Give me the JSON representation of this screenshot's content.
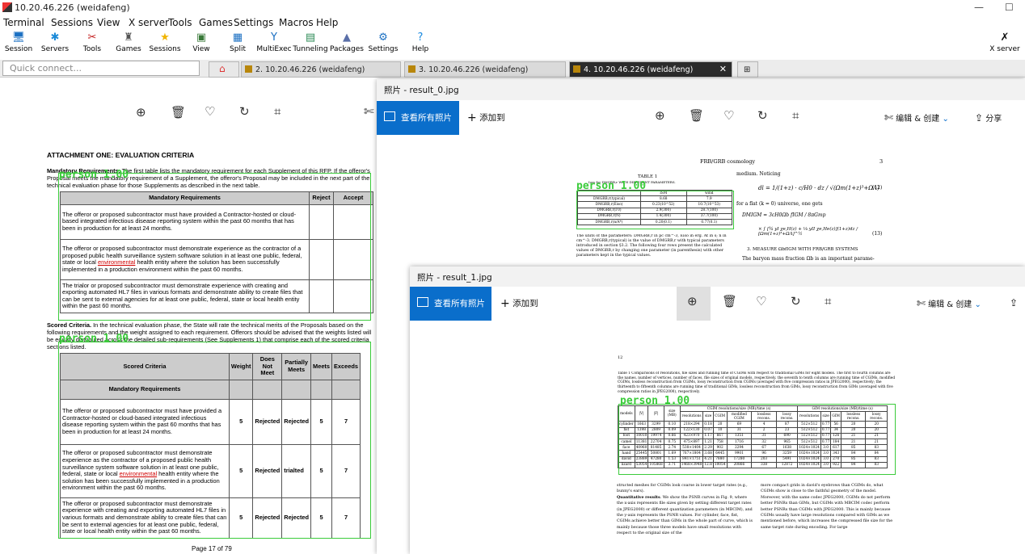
{
  "window": {
    "title": "10.20.46.226 (weidafeng)",
    "minimize": "—",
    "maximize": "☐"
  },
  "menu": [
    "Terminal",
    "Sessions",
    "View",
    "X server",
    "Tools",
    "Games",
    "Settings",
    "Macros",
    "Help"
  ],
  "toolbar": [
    {
      "label": "Session",
      "icon": "session-icon",
      "glyph": "🖥",
      "color": "#1a6fc2"
    },
    {
      "label": "Servers",
      "icon": "servers-icon",
      "glyph": "✱",
      "color": "#1b8ad8"
    },
    {
      "label": "Tools",
      "icon": "tools-icon",
      "glyph": "✂",
      "color": "#c21a1a"
    },
    {
      "label": "Games",
      "icon": "games-icon",
      "glyph": "♜",
      "color": "#555555"
    },
    {
      "label": "Sessions",
      "icon": "star-icon",
      "glyph": "★",
      "color": "#f0b400"
    },
    {
      "label": "View",
      "icon": "view-icon",
      "glyph": "▣",
      "color": "#3a7a3a"
    },
    {
      "label": "Split",
      "icon": "split-icon",
      "glyph": "▦",
      "color": "#1a6fc2"
    },
    {
      "label": "MultiExec",
      "icon": "multiexec-icon",
      "glyph": "Y",
      "color": "#1a6fc2"
    },
    {
      "label": "Tunneling",
      "icon": "tunneling-icon",
      "glyph": "▤",
      "color": "#2e8b57"
    },
    {
      "label": "Packages",
      "icon": "packages-icon",
      "glyph": "▲",
      "color": "#5a6fa8"
    },
    {
      "label": "Settings",
      "icon": "settings-icon",
      "glyph": "⚙",
      "color": "#1a6fc2"
    },
    {
      "label": "Help",
      "icon": "help-icon",
      "glyph": "?",
      "color": "#1a8ae0"
    }
  ],
  "xserver": {
    "label": "X server",
    "icon": "x-server-icon"
  },
  "quickconnect": {
    "placeholder": "Quick connect..."
  },
  "tabs": [
    {
      "label": "2. 10.20.46.226 (weidafeng)",
      "active": false
    },
    {
      "label": "3. 10.20.46.226 (weidafeng)",
      "active": false
    },
    {
      "label": "4. 10.20.46.226 (weidafeng)",
      "active": true
    }
  ],
  "left_doc": {
    "heading": "ATTACHMENT ONE:  EVALUATION CRITERIA",
    "para1_bold": "Mandatory Requirements.",
    "para1": "  The first table lists the mandatory requirement for each Supplement of this RFP.  If the offeror's Proposal meets the mandatory requirement of a Supplement, the offeror's Proposal may be included in the next part of the technical evaluation phase for those Supplements as described in the next table.",
    "t1_headers": [
      "Mandatory Requirements",
      "Reject",
      "Accept"
    ],
    "t1_rows": [
      "The offeror or proposed subcontractor must have provided a Contractor-hosted or cloud-based integrated infectious disease reporting system within the past 60 months that has been in production for at least 24 months.",
      "The offeror or proposed subcontractor must demonstrate experience as the contractor of a proposed public health surveillance system software solution in at least one public, federal, state or local ",
      "The trialor or proposed subcontractor must demonstrate experience with creating and exporting automated HL7 files in various formats and demonstrate ability to create files that can be sent to external agencies for at least one public, federal, state or local health entity within the past 60 months."
    ],
    "t1_red": "environmental",
    "t1_row2_tail": " health entity where the solution has been successfully implemented in a production environment within the past 60 months.",
    "para2_bold": "Scored Criteria.",
    "para2": "  In the technical evaluation phase, the State will rate the technical merits of the Proposals based on the following requirements and the weight assigned to each requirement.  Offerors should be advised that the weights listed will be equally distributed across the detailed sub-requirements (See Supplements 1) that comprise each of the scored criteria sections listed.",
    "t2_headers": [
      "Scored Criteria",
      "Weight",
      "Does Not Meet",
      "Partially Meets",
      "Meets",
      "Exceeds"
    ],
    "t2_section": "Mandatory Requirements",
    "t2_rows": [
      {
        "text": "The offeror or proposed subcontractor must have provided a Contractor-hosted or cloud-based integrated infectious disease reporting system within the past 60 months that has been in production for at least 24 months.",
        "weight": "5",
        "dnm": "Rejected",
        "pm": "Rejected",
        "meets": "5",
        "exc": "7"
      },
      {
        "text": "The offeror or proposed subcontractor must demonstrate experience as the contractor of a proposed public health surveillance system software solution in at least one public, federal, state or local ",
        "weight": "5",
        "dnm": "Rejected",
        "pm": "trialted",
        "meets": "5",
        "exc": "7"
      },
      {
        "text": "The offeror or proposed subcontractor must demonstrate experience with creating and exporting automated HL7 files in various formats and demonstrate ability to create files that can be sent to external agencies for at least one public, federal, state or local health entity within the past 60 months.",
        "weight": "5",
        "dnm": "Rejected",
        "pm": "Rejected",
        "meets": "5",
        "exc": "7"
      }
    ],
    "page": "Page 17 of 79",
    "label": "person 1.00"
  },
  "win0": {
    "title": "照片 - result_0.jpg",
    "view_all": "查看所有照片",
    "add_to": "添加到",
    "edit": "编辑 & 创建",
    "share": "分享",
    "header": "FRB/GRB cosmology",
    "page_no": "3",
    "table_caption": "TABLE 1",
    "table_sub": "Ioss for DMGRB,r WITH DIFFERENT PARAMETERS.",
    "label": "person 1.00",
    "cols": [
      "",
      "ISM",
      "wind"
    ],
    "rows": [
      [
        "DMGRB,r(typical)",
        "8.68",
        "7.9"
      ],
      [
        "DMGRB,r(Eiso)",
        "0.23(10^52)",
        "10.7(10^53)"
      ],
      [
        "DMGRB,r(Γ0)",
        "2.9(300)",
        "28.7(100)"
      ],
      [
        "DMGRB,r(N)",
        "1.4(300)",
        "37.7(100)"
      ],
      [
        "DMGRB,r(n/A*)",
        "0.20(0.1)",
        "0.77(0.1)"
      ]
    ],
    "text_left": "The units of the parameters: DMGRB,r in pc cm^-3, Eiso in erg. At in s; n in cm^-3. DMGRB,r(typical) is the value of DMGRB,r with typical parameters introduced in section §3.2. The following four rows present the calculated values of DMGRB,r by changing one parameter (in parenthesis) with other parameters kept in the typical values.",
    "text_right1": "medium. Noticing",
    "eq_num1": "(12)",
    "text_right2": "for a flat (k = 0) universe, one gets",
    "eq_num2": "(13)",
    "section": "3.  MEASURE ΩbfIGM WITH FRB/GRB SYSTEMS",
    "text_right3": "The baryon mass fraction Ωb is an important parame-"
  },
  "win1": {
    "title": "照片 - result_1.jpg",
    "view_all": "查看所有照片",
    "add_to": "添加到",
    "edit": "编辑 & 创建",
    "page_no": "12",
    "caption": "Table 1 Comparisons of resolutions, file sizes and running time of CGIMs with respect to traditional GIMs for eight models. The first to fourth columns are the names, number of vertices, number of faces, file sizes of original models, respectively. the seventh to tenth columns are running time of CGIMs, modified CGIMs, lossless reconstruction from CGIMs, lossy reconstruction from CGIMs (averaged with five compression ratios in JPEG2000), respectively; the thirteenth to fifteenth columns are running time of traditional GIMs, lossless reconstruction from GIMs, lossy reconstruction from GIMs (averaged with five compression ratios in JPEG2000), respectively.",
    "label": "person 1.00",
    "head1": [
      "models",
      "|V|",
      "|F|",
      "size (MB)",
      "CGIM resolutions/size (MB)/time (s)",
      "GIM resolutions/size (MB)/time (s)"
    ],
    "head2": [
      "resolutions",
      "size",
      "CGIM",
      "modified CGIM",
      "lossless recons.",
      "lossy recons.",
      "resolutions",
      "size",
      "GIM",
      "lossless recons.",
      "lossy recons."
    ],
    "rows": [
      [
        "cylinder",
        "1663",
        "3299",
        "0.10",
        "218×294",
        "0.18",
        "20",
        "69",
        "4",
        "87",
        "512×512",
        "0.77",
        "56",
        "20",
        "20"
      ],
      [
        "fist",
        "1398",
        "2809",
        "0.09",
        "122×130",
        "0.07",
        "10",
        "31",
        "2",
        "23",
        "512×512",
        "0.77",
        "34",
        "20",
        "20"
      ],
      [
        "foot",
        "10010",
        "19974",
        "0.66",
        "423×970",
        "1.17",
        "667",
        "1351",
        "31",
        "690",
        "512×512",
        "0.77",
        "126",
        "21",
        "21"
      ],
      [
        "camel",
        "11381",
        "22704",
        "0.75",
        "475×897",
        "1.21",
        "758",
        "1716",
        "32",
        "965",
        "512×512",
        "0.77",
        "184",
        "21",
        "21"
      ],
      [
        "face",
        "40960",
        "81485",
        "2.74",
        "538×1404",
        "2.29",
        "902",
        "2294",
        "67",
        "1638",
        "1024×1024",
        "3.0",
        "617",
        "85",
        "83"
      ],
      [
        "hand",
        "25445",
        "50801",
        "1.69",
        "767×1804",
        "3.68",
        "6445",
        "9901",
        "96",
        "3259",
        "1024×1024",
        "3.0",
        "343",
        "84",
        "84"
      ],
      [
        "david",
        "23889",
        "47280",
        "1.53",
        "841×1751",
        "4.21",
        "7880",
        "17280",
        "203",
        "5491",
        "1024×1024",
        "3.0",
        "270",
        "85",
        "83"
      ],
      [
        "lizard",
        "53054",
        "105868",
        "3.71",
        "1468×3948",
        "12.8",
        "10054",
        "20866",
        "338",
        "12872",
        "1024×1024",
        "3.0",
        "922",
        "84",
        "83"
      ]
    ],
    "col1": [
      "structed meshes for CGIMs look coarse in lower target rates (e.g., bunny's ears).",
      "Quantitative results",
      ". We show the PSNR curves in Fig. 9, where the x-axis represents file sizes given by setting different target rates (in JPEG2000) or different quantization parameters (in MBCIM), and the y-axis represents the PSNR values. For cylinder, face, fist, CGIMs achieve better than GIMs in the whole part of curve, which is mainly because those three models have small resolutions with respect to the original size of the"
    ],
    "col2": "more compact grids in david's eyebrows than CGIMs do, what CGIMs show is close to the faithful geometry of the model. Moreover, with the same codec JPEG2000, CGIMs do not perform better PSNRs than GIMs, but CGIMs with MBCIM codec perform better PSNRs than CGIMs with JPEG2000. This is mainly because CGIMs usually have large resolutions compared with GIMs as we mentioned before, which increases the compressed file size for the same target rate during encoding. For large"
  }
}
